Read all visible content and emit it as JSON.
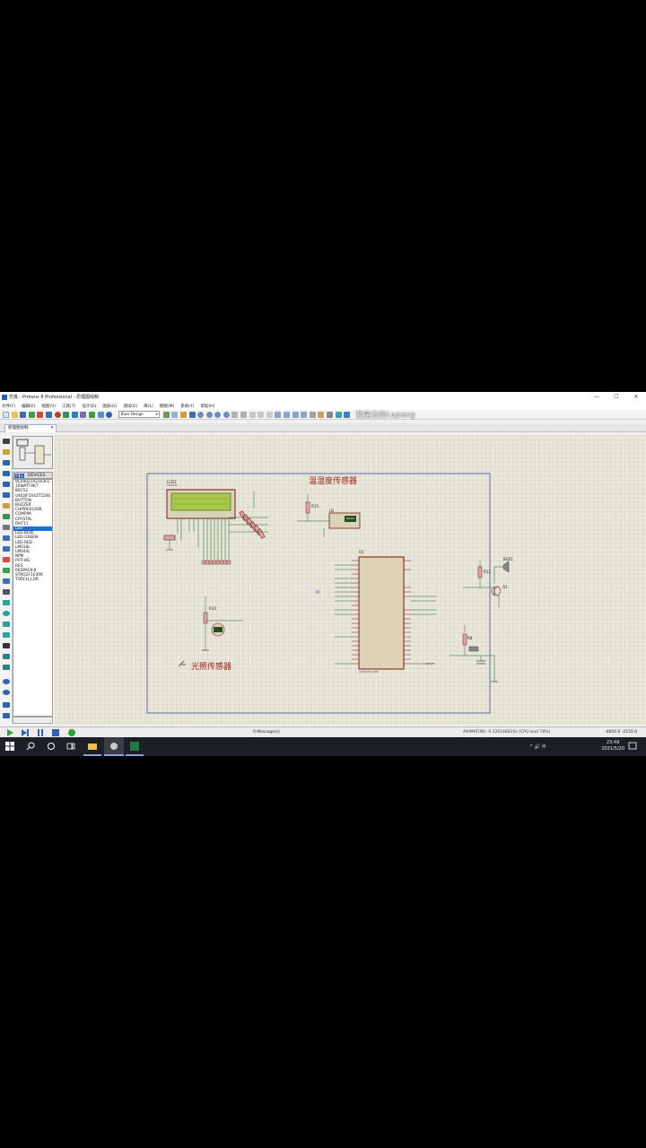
{
  "window": {
    "title": "仿真 - Proteus 8 Professional - 原理图绘制",
    "controls": [
      "—",
      "☐",
      "✕"
    ]
  },
  "menu": [
    "文件(F)",
    "编辑(E)",
    "视图(V)",
    "工具(T)",
    "设计(D)",
    "图表(G)",
    "调试(D)",
    "库(L)",
    "模版(M)",
    "系统(Y)",
    "帮助(H)"
  ],
  "toolbar": {
    "design_combo": "Base Design",
    "overlay_text": "我是杰的Lopeng"
  },
  "tab": {
    "label": "原理图绘制",
    "close": "✕"
  },
  "devices": {
    "header_p": "P",
    "header_l": "L",
    "header_label": "DEVICES",
    "items": [
      "9C04021A2103FL…",
      "10WATT4K7",
      "80C52",
      "0402JF1042T5200",
      "BUTTON",
      "BUZZER",
      "CHIPRES100K",
      "COMPIM",
      "CRYSTAL",
      "DHT11",
      "LED",
      "LED-BLUE",
      "LED-GREEN",
      "LED-RED",
      "LM016L",
      "LM044L",
      "NPN",
      "POT-HG",
      "RES",
      "RESPACK-8",
      "STM32F103R6",
      "TORCH_LDR"
    ],
    "selected_index": 10
  },
  "schematic": {
    "label_temp_humidity": "温湿度传感器",
    "label_light": "光照传感器",
    "lcd_ref": "LCD1",
    "lcd_part": "LM016L",
    "mcu_ref": "U1",
    "mcu_part": "STM32F103R6",
    "dht_ref": "U2",
    "buzzer_ref": "BUZ1",
    "transistor_ref": "Q1",
    "ldr_ref": "R10",
    "r15": "R15",
    "r12": "R12",
    "r8": "R8",
    "reset_label": "RESET"
  },
  "status": {
    "messages": "0 Message(s)",
    "animating": "ANIMATING: 0.326148625s (CPU load 78%)",
    "coords": "-4850.0   -2150.0"
  },
  "taskbar": {
    "tray": "^ 🔊 中",
    "time": "23:49",
    "date": "2021/5/20"
  }
}
